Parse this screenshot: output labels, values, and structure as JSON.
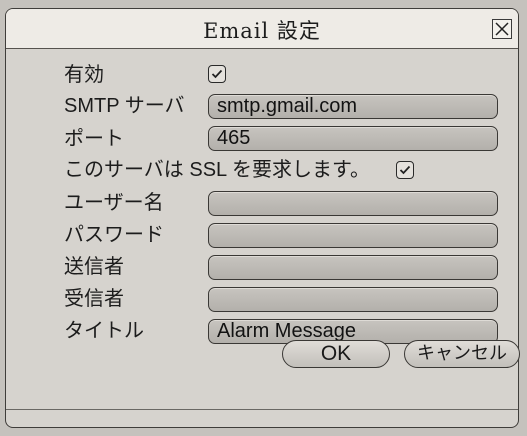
{
  "dialog": {
    "title": "Email 設定",
    "close_icon": "close-x-icon"
  },
  "form": {
    "enabled_label": "有効",
    "enabled_checked": true,
    "smtp_server_label": "SMTP サーバ",
    "smtp_server_value": "smtp.gmail.com",
    "port_label": "ポート",
    "port_value": "465",
    "ssl_label": "このサーバは SSL を要求します。",
    "ssl_checked": true,
    "username_label": "ユーザー名",
    "username_value": "",
    "password_label": "パスワード",
    "password_value": "",
    "sender_label": "送信者",
    "sender_value": "",
    "recipient_label": "受信者",
    "recipient_value": "",
    "title_label": "タイトル",
    "title_value": "Alarm Message"
  },
  "buttons": {
    "ok_label": "OK",
    "cancel_label": "キャンセル"
  }
}
